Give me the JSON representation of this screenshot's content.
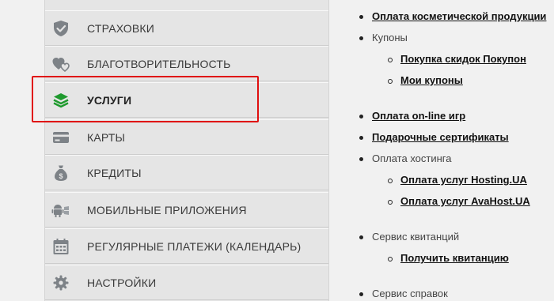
{
  "sidebar": {
    "items": [
      {
        "label": "СТРАХОВКИ",
        "icon": "shield-check-icon"
      },
      {
        "label": "БЛАГОТВОРИТЕЛЬНОСТЬ",
        "icon": "hearts-icon"
      },
      {
        "label": "УСЛУГИ",
        "icon": "stacked-layers-icon",
        "active": true
      },
      {
        "label": "КАРТЫ",
        "icon": "credit-card-icon"
      },
      {
        "label": "КРЕДИТЫ",
        "icon": "money-bag-icon"
      },
      {
        "label": "МОБИЛЬНЫЕ ПРИЛОЖЕНИЯ",
        "icon": "mobile-apps-icon"
      },
      {
        "label": "РЕГУЛЯРНЫЕ ПЛАТЕЖИ (КАЛЕНДАРЬ)",
        "icon": "calendar-icon"
      },
      {
        "label": "НАСТРОЙКИ",
        "icon": "gear-icon"
      }
    ]
  },
  "content": {
    "items": [
      {
        "text": "Оплата косметической продукции",
        "link": true
      },
      {
        "text": "Купоны",
        "link": false
      },
      {
        "text": "Покупка скидок Покупон",
        "link": true
      },
      {
        "text": "Мои купоны",
        "link": true
      },
      {
        "text": "Оплата on-line игр",
        "link": true
      },
      {
        "text": "Подарочные сертификаты",
        "link": true
      },
      {
        "text": "Оплата хостинга",
        "link": false
      },
      {
        "text": "Оплата услуг Hosting.UA",
        "link": true
      },
      {
        "text": "Оплата услуг AvaHost.UA",
        "link": true
      },
      {
        "text": "Сервис квитанций",
        "link": false
      },
      {
        "text": "Получить квитанцию",
        "link": true
      },
      {
        "text": "Сервис справок",
        "link": false
      }
    ]
  },
  "colors": {
    "highlight_border": "#e01010",
    "active_icon": "#1f9a2e",
    "icon_gray": "#7d8287"
  }
}
